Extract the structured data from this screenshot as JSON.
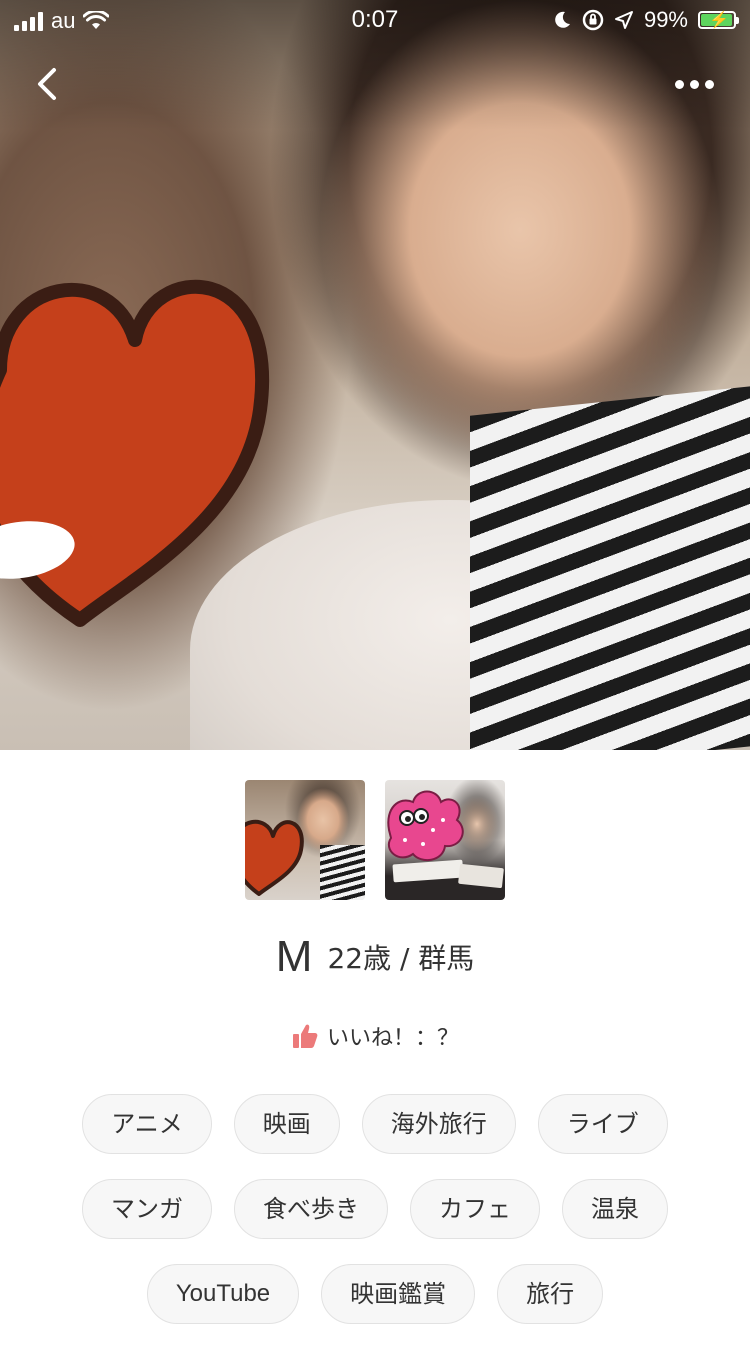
{
  "status_bar": {
    "carrier": "au",
    "time": "0:07",
    "battery_percent": "99%",
    "icons": [
      "signal-icon",
      "wifi-icon",
      "moon-icon",
      "orientation-lock-icon",
      "location-icon",
      "battery-charging-icon"
    ]
  },
  "nav": {
    "back_icon": "chevron-left-icon",
    "more_icon": "more-dots-icon"
  },
  "profile": {
    "name": "M",
    "age_location": "22歳 / 群馬",
    "likes_label": "いいね！：？",
    "likes_icon": "thumbs-up-icon",
    "photos_count": 2
  },
  "tags": [
    [
      "アニメ",
      "映画",
      "海外旅行",
      "ライブ"
    ],
    [
      "マンガ",
      "食べ歩き",
      "カフェ",
      "温泉"
    ],
    [
      "YouTube",
      "映画鑑賞",
      "旅行"
    ]
  ],
  "colors": {
    "heart_sticker": "#c5401b",
    "thumbs_up": "#ec7a7a",
    "tag_border": "#e2e2e2",
    "tag_bg": "#f7f7f7",
    "battery_fill": "#5ed55e"
  }
}
